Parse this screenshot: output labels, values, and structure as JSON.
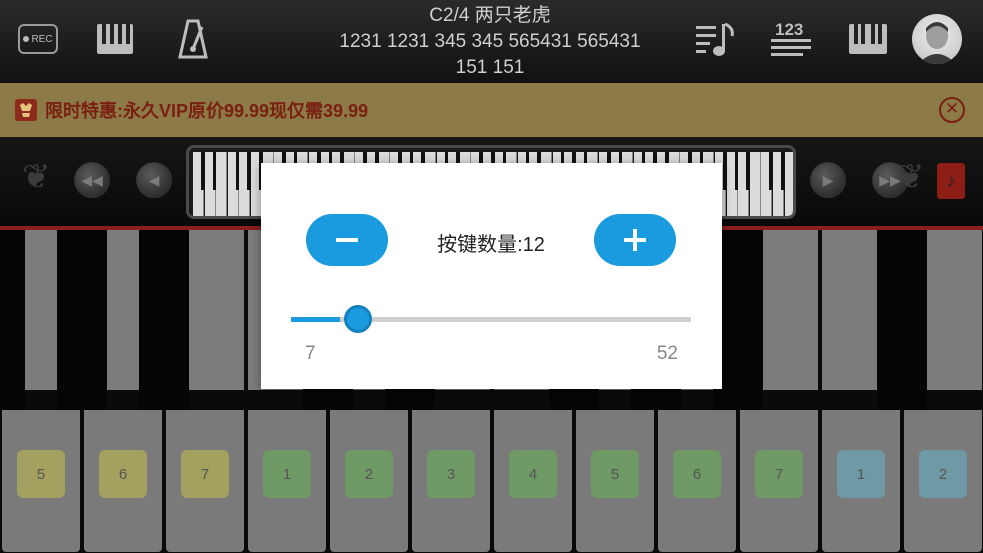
{
  "toolbar": {
    "song_title_line1": "C2/4 两只老虎",
    "song_title_line2": "1231 1231 345 345 565431 565431",
    "song_title_line3": "151 151",
    "rec_label": "REC",
    "icons": [
      "record-icon",
      "piano-keys-icon",
      "metronome-icon",
      "sheet-music-icon",
      "numbered-notation-icon",
      "keyboard-layout-icon",
      "avatar"
    ]
  },
  "promo": {
    "text": "限时特惠:永久VIP原价99.99现仅需39.99",
    "close_glyph": "✕"
  },
  "dialog": {
    "minus_glyph": "−",
    "plus_glyph": "+",
    "count_label": "按键数量:12",
    "slider_min": "7",
    "slider_max": "52",
    "slider_value": 12,
    "slider_min_value": 7,
    "slider_max_value": 52
  },
  "piano": {
    "white_key_labels": [
      "5",
      "6",
      "7",
      "1",
      "2",
      "3",
      "4",
      "5",
      "6",
      "7",
      "1",
      "2"
    ],
    "label_colors": [
      "#a3a060",
      "#a3a060",
      "#a3a060",
      "#6f9a66",
      "#6f9a66",
      "#6f9a66",
      "#6f9a66",
      "#6f9a66",
      "#6f9a66",
      "#6f9a66",
      "#6f9aa5",
      "#6f9aa5"
    ]
  },
  "colors": {
    "accent": "#1a9be0",
    "promo_bg": "#8c7a47",
    "promo_text": "#7a1f12"
  }
}
